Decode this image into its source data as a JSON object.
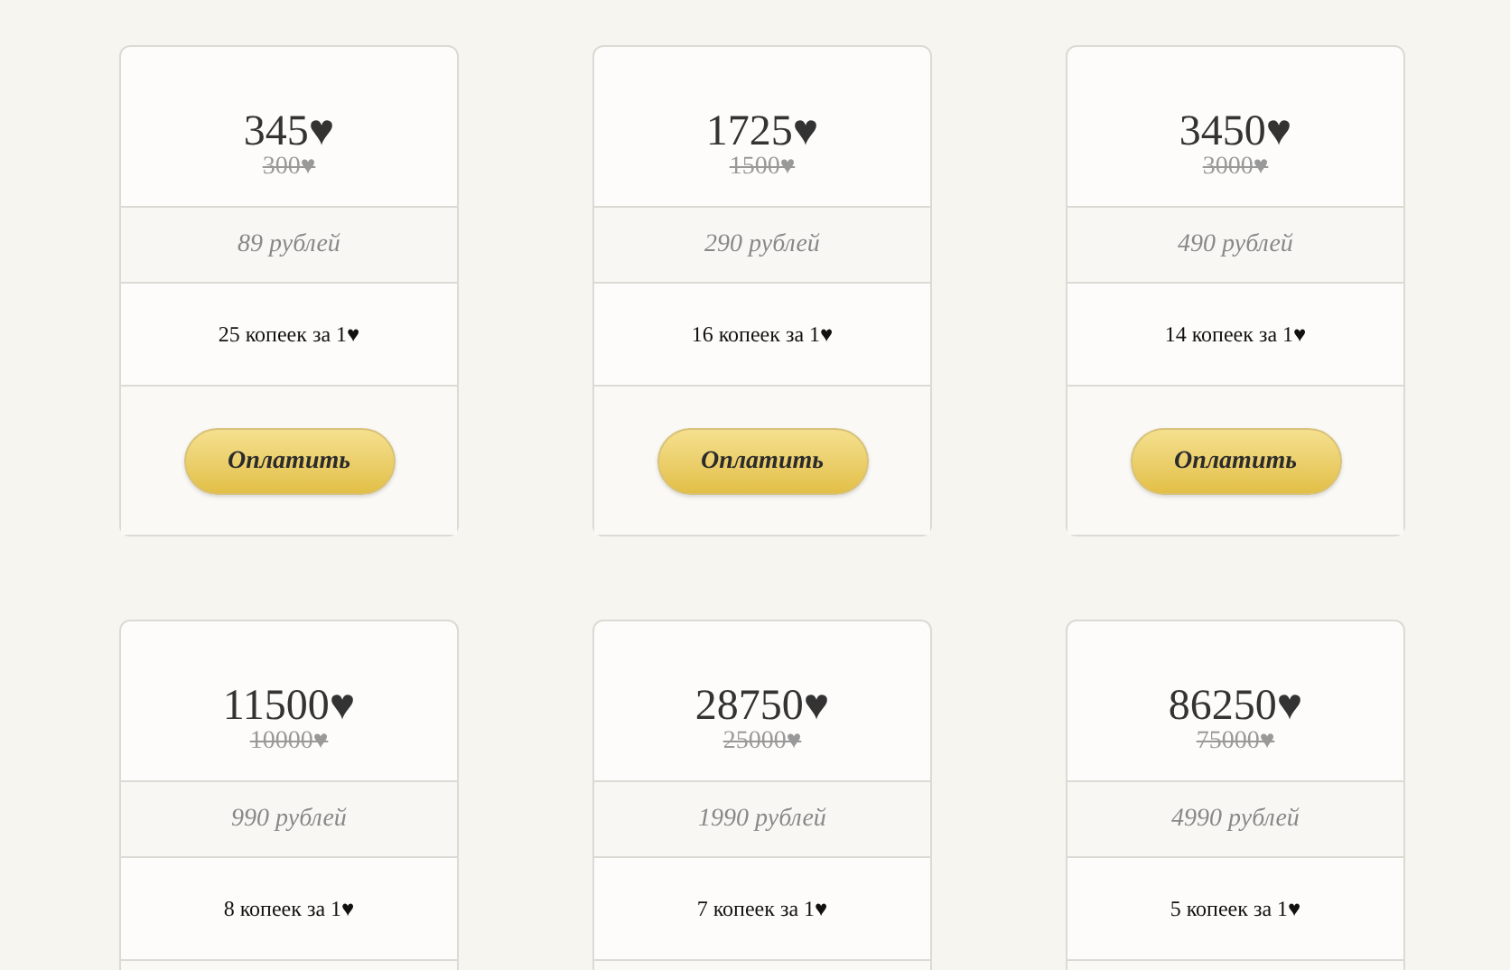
{
  "plans": [
    {
      "amount": "345♥",
      "old_amount": "300♥",
      "price": "89 рублей",
      "rate": "25 копеек за 1♥",
      "button": "Оплатить"
    },
    {
      "amount": "1725♥",
      "old_amount": "1500♥",
      "price": "290 рублей",
      "rate": "16 копеек за 1♥",
      "button": "Оплатить"
    },
    {
      "amount": "3450♥",
      "old_amount": "3000♥",
      "price": "490 рублей",
      "rate": "14 копеек за 1♥",
      "button": "Оплатить"
    },
    {
      "amount": "11500♥",
      "old_amount": "10000♥",
      "price": "990 рублей",
      "rate": "8 копеек за 1♥"
    },
    {
      "amount": "28750♥",
      "old_amount": "25000♥",
      "price": "1990 рублей",
      "rate": "7 копеек за 1♥"
    },
    {
      "amount": "86250♥",
      "old_amount": "75000♥",
      "price": "4990 рублей",
      "rate": "5 копеек за 1♥"
    }
  ]
}
